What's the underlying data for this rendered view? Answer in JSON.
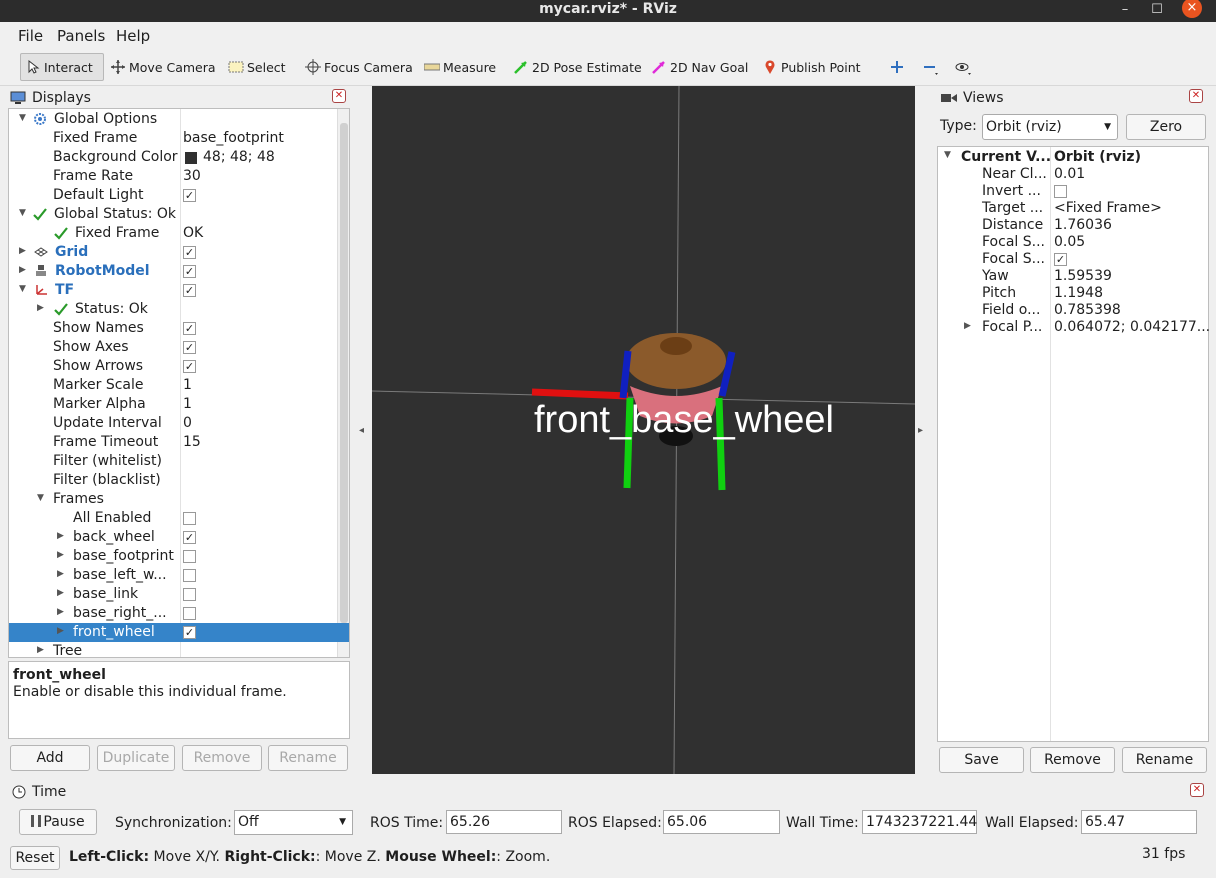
{
  "window": {
    "title": "mycar.rviz* - RViz",
    "min": "–",
    "max": "☐",
    "close": "×"
  },
  "menu": [
    "File",
    "Panels",
    "Help"
  ],
  "toolbar": {
    "interact": "Interact",
    "move_camera": "Move Camera",
    "select": "Select",
    "focus_camera": "Focus Camera",
    "measure": "Measure",
    "pose_estimate": "2D Pose Estimate",
    "nav_goal": "2D Nav Goal",
    "publish_point": "Publish Point"
  },
  "displays": {
    "title": "Displays",
    "rows": [
      {
        "label": "Global Options"
      },
      {
        "label": "Fixed Frame",
        "value": "base_footprint"
      },
      {
        "label": "Background Color",
        "value": "48; 48; 48"
      },
      {
        "label": "Frame Rate",
        "value": "30"
      },
      {
        "label": "Default Light",
        "checked": "✓"
      },
      {
        "label": "Global Status: Ok"
      },
      {
        "label": "Fixed Frame",
        "value": "OK"
      },
      {
        "label": "Grid",
        "checked": "✓"
      },
      {
        "label": "RobotModel",
        "checked": "✓"
      },
      {
        "label": "TF",
        "checked": "✓"
      },
      {
        "label": "Status: Ok"
      },
      {
        "label": "Show Names",
        "checked": "✓"
      },
      {
        "label": "Show Axes",
        "checked": "✓"
      },
      {
        "label": "Show Arrows",
        "checked": "✓"
      },
      {
        "label": "Marker Scale",
        "value": "1"
      },
      {
        "label": "Marker Alpha",
        "value": "1"
      },
      {
        "label": "Update Interval",
        "value": "0"
      },
      {
        "label": "Frame Timeout",
        "value": "15"
      },
      {
        "label": "Filter (whitelist)"
      },
      {
        "label": "Filter (blacklist)"
      },
      {
        "label": "Frames"
      },
      {
        "label": "All Enabled",
        "checked": ""
      },
      {
        "label": "back_wheel",
        "checked": "✓"
      },
      {
        "label": "base_footprint",
        "checked": ""
      },
      {
        "label": "base_left_w...",
        "checked": ""
      },
      {
        "label": "base_link",
        "checked": ""
      },
      {
        "label": "base_right_...",
        "checked": ""
      },
      {
        "label": "front_wheel",
        "checked": "✓"
      },
      {
        "label": "Tree"
      }
    ],
    "desc_title": "front_wheel",
    "desc_text": "Enable or disable this individual frame.",
    "buttons": {
      "add": "Add",
      "duplicate": "Duplicate",
      "remove": "Remove",
      "rename": "Rename"
    }
  },
  "viewport": {
    "label": "front_base_wheel",
    "bg": "#303030"
  },
  "views": {
    "title": "Views",
    "type_label": "Type:",
    "type_value": "Orbit (rviz)",
    "zero": "Zero",
    "header_key": "Current V...",
    "header_val": "Orbit (rviz)",
    "rows": [
      {
        "k": "Near Cl...",
        "v": "0.01"
      },
      {
        "k": "Invert ...",
        "v": ""
      },
      {
        "k": "Target ...",
        "v": "<Fixed Frame>"
      },
      {
        "k": "Distance",
        "v": "1.76036"
      },
      {
        "k": "Focal S...",
        "v": "0.05"
      },
      {
        "k": "Focal S...",
        "v": "✓"
      },
      {
        "k": "Yaw",
        "v": "1.59539"
      },
      {
        "k": "Pitch",
        "v": "1.1948"
      },
      {
        "k": "Field o...",
        "v": "0.785398"
      },
      {
        "k": "Focal P...",
        "v": "0.064072; 0.042177..."
      }
    ],
    "buttons": {
      "save": "Save",
      "remove": "Remove",
      "rename": "Rename"
    }
  },
  "time": {
    "title": "Time",
    "pause": "Pause",
    "sync_label": "Synchronization:",
    "sync_value": "Off",
    "ros_time_label": "ROS Time:",
    "ros_time": "65.26",
    "ros_elapsed_label": "ROS Elapsed:",
    "ros_elapsed": "65.06",
    "wall_time_label": "Wall Time:",
    "wall_time": "1743237221.44",
    "wall_elapsed_label": "Wall Elapsed:",
    "wall_elapsed": "65.47"
  },
  "status": {
    "reset": "Reset",
    "left": "Left-Click:",
    "left_t": " Move X/Y. ",
    "right": "Right-Click:",
    "right_t": ": Move Z. ",
    "wheel": "Mouse Wheel:",
    "wheel_t": ": Zoom.",
    "fps": "31 fps"
  }
}
